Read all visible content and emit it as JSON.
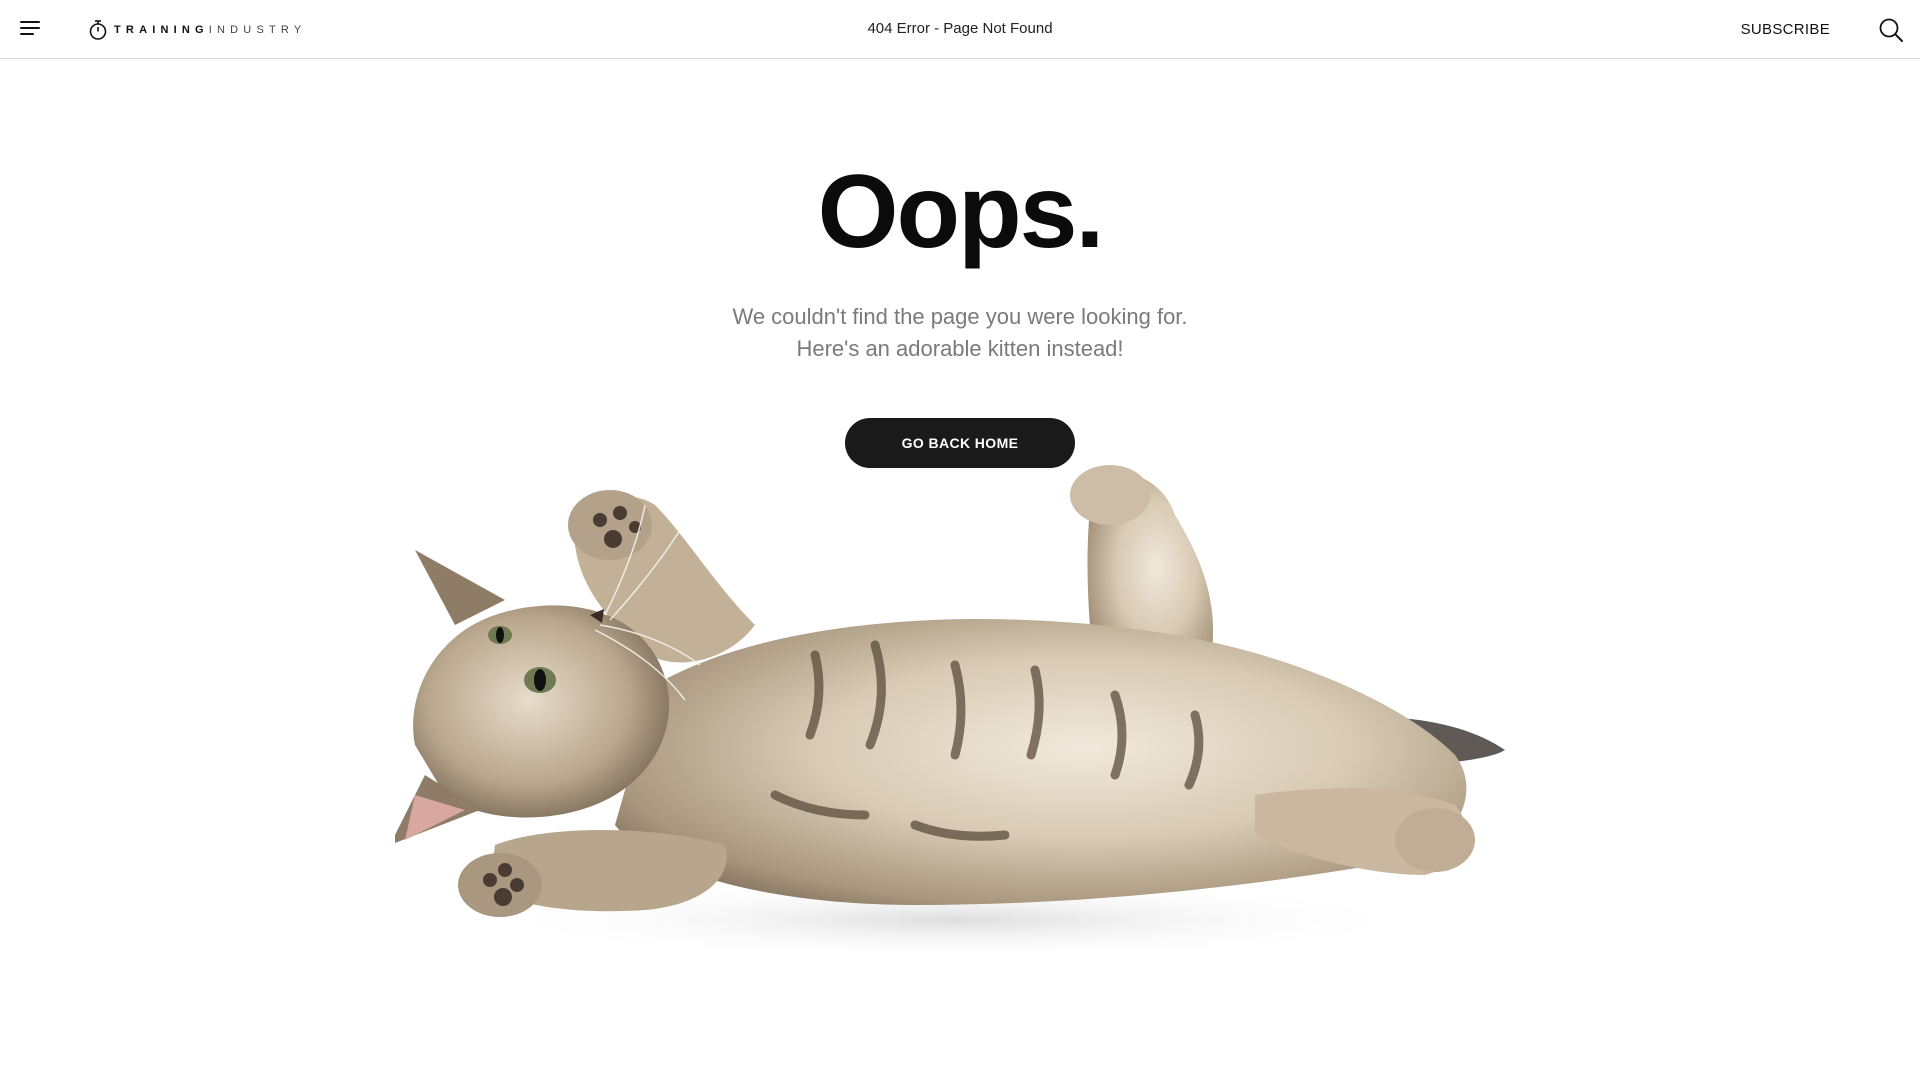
{
  "header": {
    "logo": {
      "strong": "TRAINING",
      "light": "INDUSTRY"
    },
    "page_heading": "404 Error - Page Not Found",
    "subscribe_label": "SUBSCRIBE",
    "icons": {
      "menu": "hamburger-menu-icon",
      "search": "search-icon",
      "logo": "stopwatch-icon"
    }
  },
  "main": {
    "heading": "Oops.",
    "line1": "We couldn't find the page you were looking for.",
    "line2": "Here's an adorable kitten instead!",
    "button_label": "GO BACK HOME"
  },
  "colors": {
    "text": "#0b0b0b",
    "muted": "#7a7a7a",
    "button_bg": "#1a1a1a",
    "button_text": "#ffffff",
    "divider": "#d9d9d9"
  }
}
